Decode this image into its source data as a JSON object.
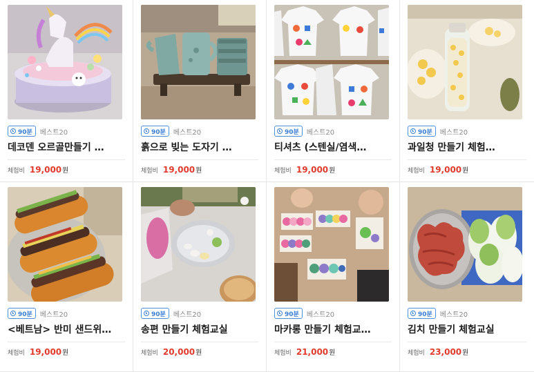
{
  "products": [
    {
      "duration": "90분",
      "tag": "베스트20",
      "title": "데코덴 오르골만들기 …",
      "price_label": "체험비",
      "price": "19,000",
      "unit": "원",
      "image": "unicorn music box"
    },
    {
      "duration": "90분",
      "tag": "베스트20",
      "title": "흙으로 빚는 도자기 …",
      "price_label": "체험비",
      "price": "19,000",
      "unit": "원",
      "image": "clay pottery mugs"
    },
    {
      "duration": "90분",
      "tag": "베스트20",
      "title": "티셔츠 (스텐실/염색…",
      "price_label": "체험비",
      "price": "19,000",
      "unit": "원",
      "image": "stencil t-shirts"
    },
    {
      "duration": "90분",
      "tag": "베스트20",
      "title": "과일청 만들기 체험…",
      "price_label": "체험비",
      "price": "19,000",
      "unit": "원",
      "image": "fruit syrup jar"
    },
    {
      "duration": "90분",
      "tag": "베스트20",
      "title": "<베트남> 반미 샌드위…",
      "price_label": "체험비",
      "price": "19,000",
      "unit": "원",
      "image": "banh mi sandwiches"
    },
    {
      "duration": "90분",
      "tag": "베스트20",
      "title": "송편 만들기 체험교실",
      "price_label": "체험비",
      "price": "20,000",
      "unit": "원",
      "image": "songpyeon rice cakes"
    },
    {
      "duration": "90분",
      "tag": "베스트20",
      "title": "마카롱 만들기 체험교…",
      "price_label": "체험비",
      "price": "21,000",
      "unit": "원",
      "image": "macarons in boxes"
    },
    {
      "duration": "90분",
      "tag": "베스트20",
      "title": "김치 만들기 체험교실",
      "price_label": "체험비",
      "price": "23,000",
      "unit": "원",
      "image": "kimchi and cabbage"
    }
  ],
  "colors": {
    "badge": "#3a7fd6",
    "price": "#e23b2e",
    "divider": "#e8e8e8"
  }
}
